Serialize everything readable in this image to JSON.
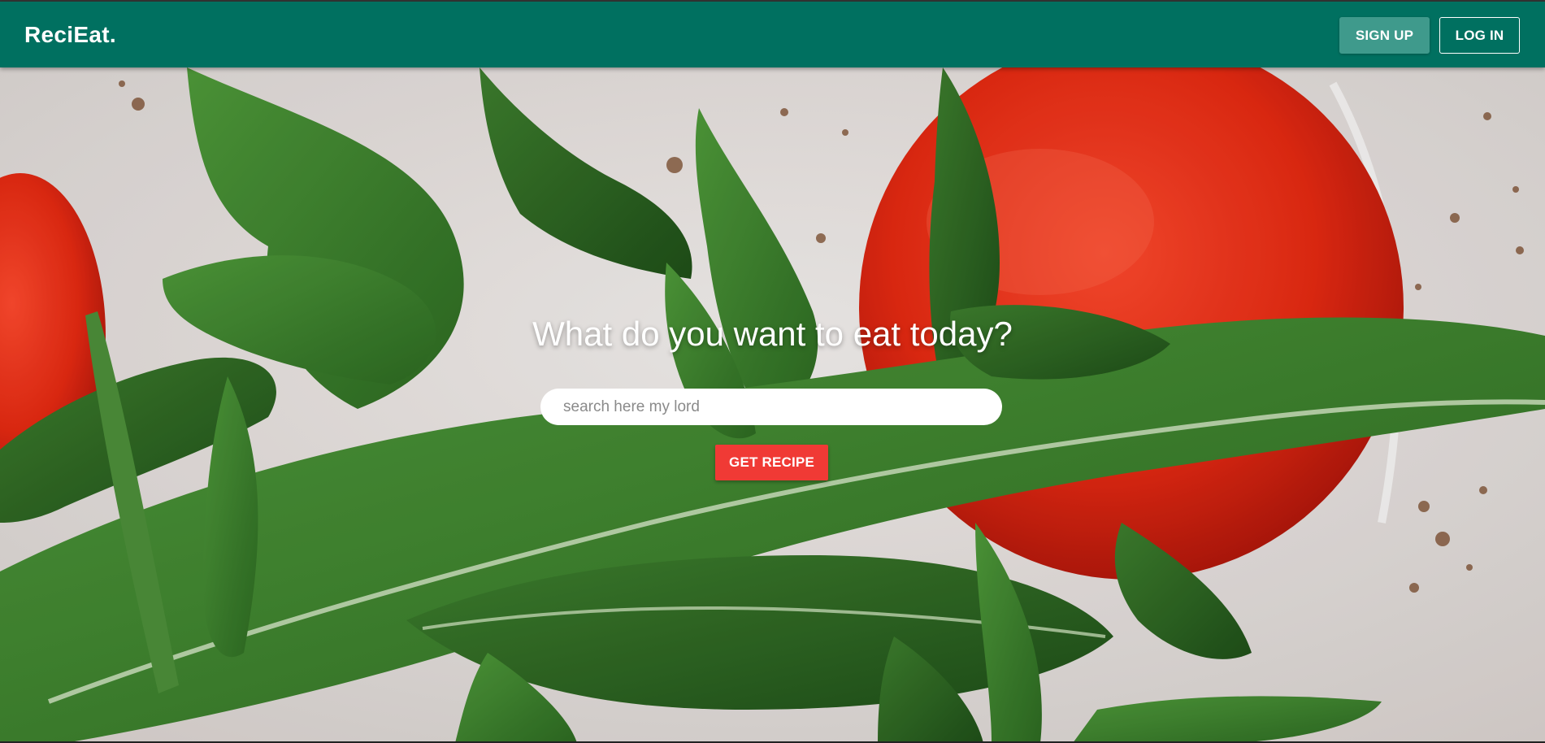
{
  "navbar": {
    "brand": "ReciEat.",
    "signup_label": "SIGN UP",
    "login_label": "LOG IN",
    "background_color": "#007060"
  },
  "hero": {
    "headline": "What do you want to eat today?",
    "search": {
      "placeholder": "search here my lord",
      "value": ""
    },
    "submit_label": "GET RECIPE",
    "submit_color": "#f03a35",
    "background_image": "arugula-and-tomato-photo"
  }
}
